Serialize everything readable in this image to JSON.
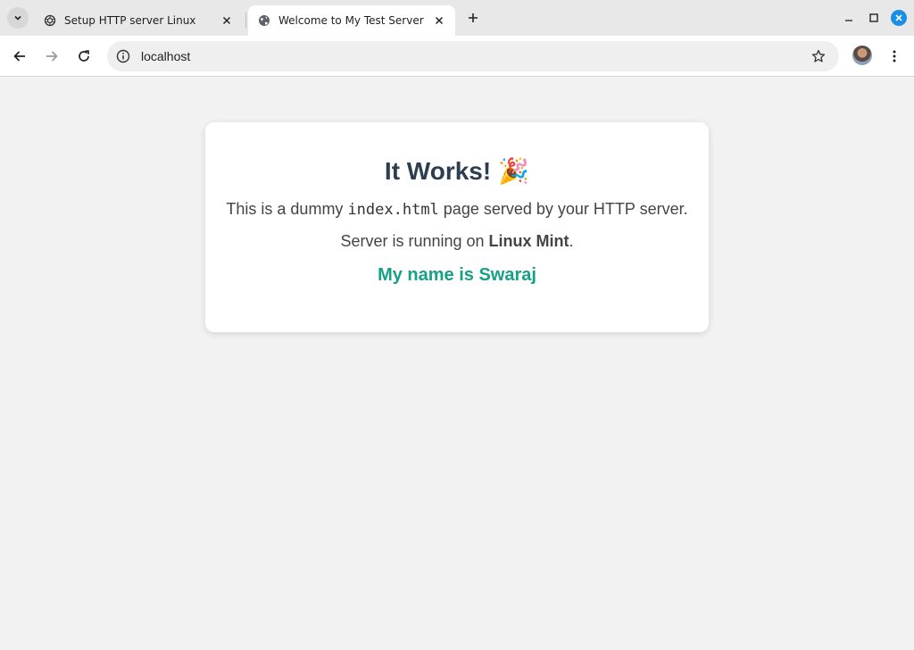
{
  "tabs": [
    {
      "title": "Setup HTTP server Linux",
      "active": false,
      "icon": "openai-icon"
    },
    {
      "title": "Welcome to My Test Server",
      "active": true,
      "icon": "globe-icon"
    }
  ],
  "address_bar": {
    "url": "localhost"
  },
  "page": {
    "heading": "It Works!",
    "heading_emoji": "🎉",
    "line1_prefix": "This is a dummy ",
    "line1_code": "index.html",
    "line1_suffix": " page served by your HTTP server.",
    "line2_prefix": "Server is running on ",
    "line2_bold": "Linux Mint",
    "line2_suffix": ".",
    "name_line": "My name is Swaraj"
  },
  "colors": {
    "heading": "#2c3e50",
    "name_line": "#16a085",
    "window_close": "#1a8fe8"
  }
}
